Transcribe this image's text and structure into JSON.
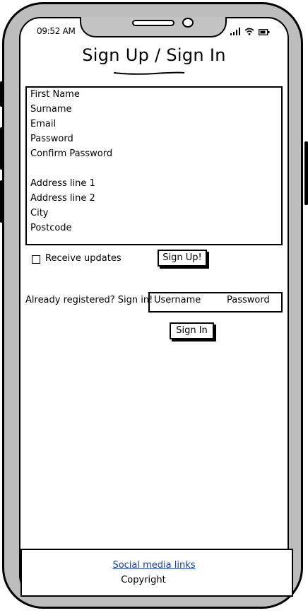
{
  "status_bar": {
    "time": "09:52 AM"
  },
  "page": {
    "title": "Sign Up / Sign In"
  },
  "signup_form": {
    "fields": [
      "First Name",
      "Surname",
      "Email",
      "Password",
      "Confirm Password",
      "Address line 1",
      "Address line 2",
      "City",
      "Postcode"
    ],
    "receive_updates_label": "Receive updates",
    "receive_updates_checked": false,
    "submit_label": "Sign Up!"
  },
  "signin": {
    "prompt": "Already registered? Sign in!",
    "username_placeholder": "Username",
    "password_placeholder": "Password",
    "submit_label": "Sign In"
  },
  "footer": {
    "social_link": "Social media links",
    "copyright": "Copyright"
  },
  "colors": {
    "link": "#1a3f8a",
    "frame": "#bdbdbd"
  }
}
